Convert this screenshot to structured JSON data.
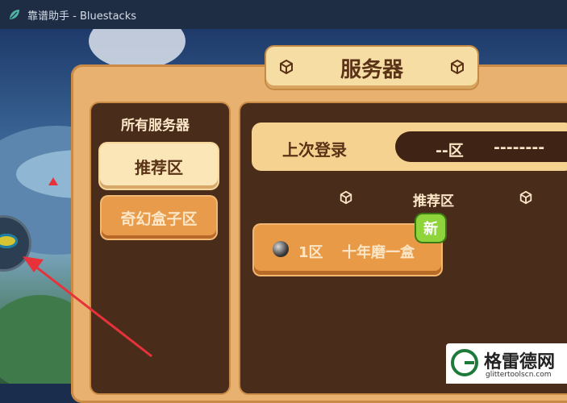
{
  "window": {
    "title": "靠谱助手 - Bluestacks"
  },
  "header": {
    "title": "服务器"
  },
  "sidebar": {
    "title": "所有服务器",
    "items": [
      {
        "label": "推荐区",
        "selected": true
      },
      {
        "label": "奇幻盒子区",
        "selected": false
      }
    ]
  },
  "last_login": {
    "label": "上次登录",
    "zone": "--区",
    "name": "--------"
  },
  "section": {
    "title": "推荐区"
  },
  "servers": [
    {
      "zone": "1区",
      "name": "十年磨一盒",
      "badge": "新"
    }
  ],
  "watermark": {
    "brand": "格雷德网",
    "url": "glittertoolscn.com"
  },
  "colors": {
    "accent": "#e99a47",
    "panel": "#e9b170",
    "dark": "#4a2c1b",
    "badge": "#8ed43a",
    "arrow": "#e8323a"
  }
}
